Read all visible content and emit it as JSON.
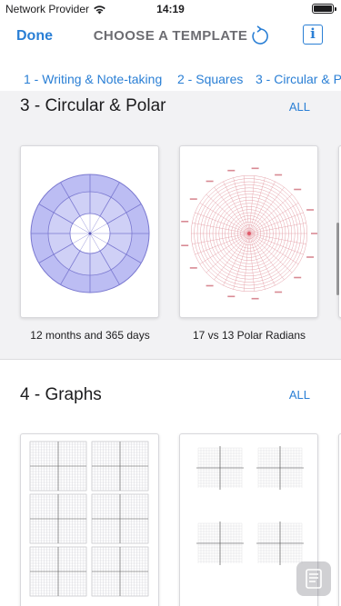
{
  "status_bar": {
    "carrier": "Network Provider",
    "time": "14:19",
    "wifi_icon": "wifi-icon",
    "battery_icon": "battery-icon",
    "battery_level": 1.0
  },
  "nav": {
    "done_label": "Done",
    "title": "CHOOSE A TEMPLATE",
    "refresh_icon": "refresh-icon",
    "info_icon": "info-icon",
    "info_glyph": "i"
  },
  "tabs": [
    {
      "label": "1 - Writing & Note-taking"
    },
    {
      "label": "2 - Squares"
    },
    {
      "label": "3 - Circular & Polar"
    }
  ],
  "sections": [
    {
      "title": "3 - Circular & Polar",
      "all_label": "ALL",
      "items": [
        {
          "label": "12 months and 365 days",
          "thumbnail": "polar-months-thumbnail"
        },
        {
          "label": "17 vs 13 Polar Radians",
          "thumbnail": "polar-radians-thumbnail"
        }
      ]
    },
    {
      "title": "4 - Graphs",
      "all_label": "ALL",
      "items": [
        {
          "label": "",
          "thumbnail": "six-grid-graph-thumbnail"
        },
        {
          "label": "",
          "thumbnail": "four-axes-graph-thumbnail"
        }
      ]
    }
  ],
  "colors": {
    "accent": "#2a7fd5",
    "section_background": "#f2f2f4",
    "polar_fill": "#bcbdf3",
    "polar_lines": "#7a78d0",
    "radian_lines": "#e4a0a8"
  }
}
